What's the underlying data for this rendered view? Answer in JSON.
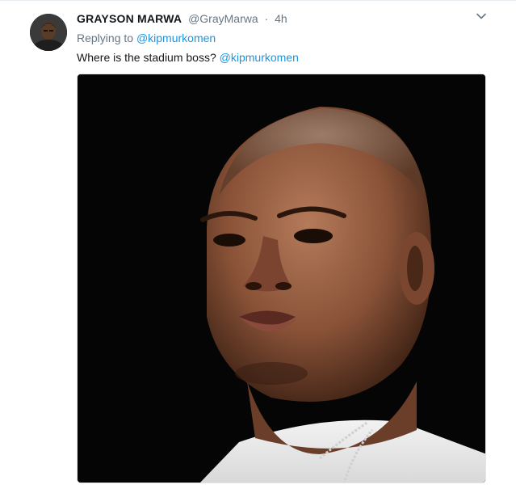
{
  "tweet": {
    "fullname": "GRAYSON MARWA",
    "handle": "@GrayMarwa",
    "separator": "·",
    "time": "4h",
    "replying_prefix": "Replying to",
    "replying_to": "@kipmurkomen",
    "text_main": "Where is the stadium boss?",
    "text_mention": "@kipmurkomen"
  },
  "colors": {
    "link": "#1b95e0",
    "secondary_text": "#657786",
    "primary_text": "#14171a"
  },
  "icons": {
    "menu": "chevron-down-icon"
  }
}
